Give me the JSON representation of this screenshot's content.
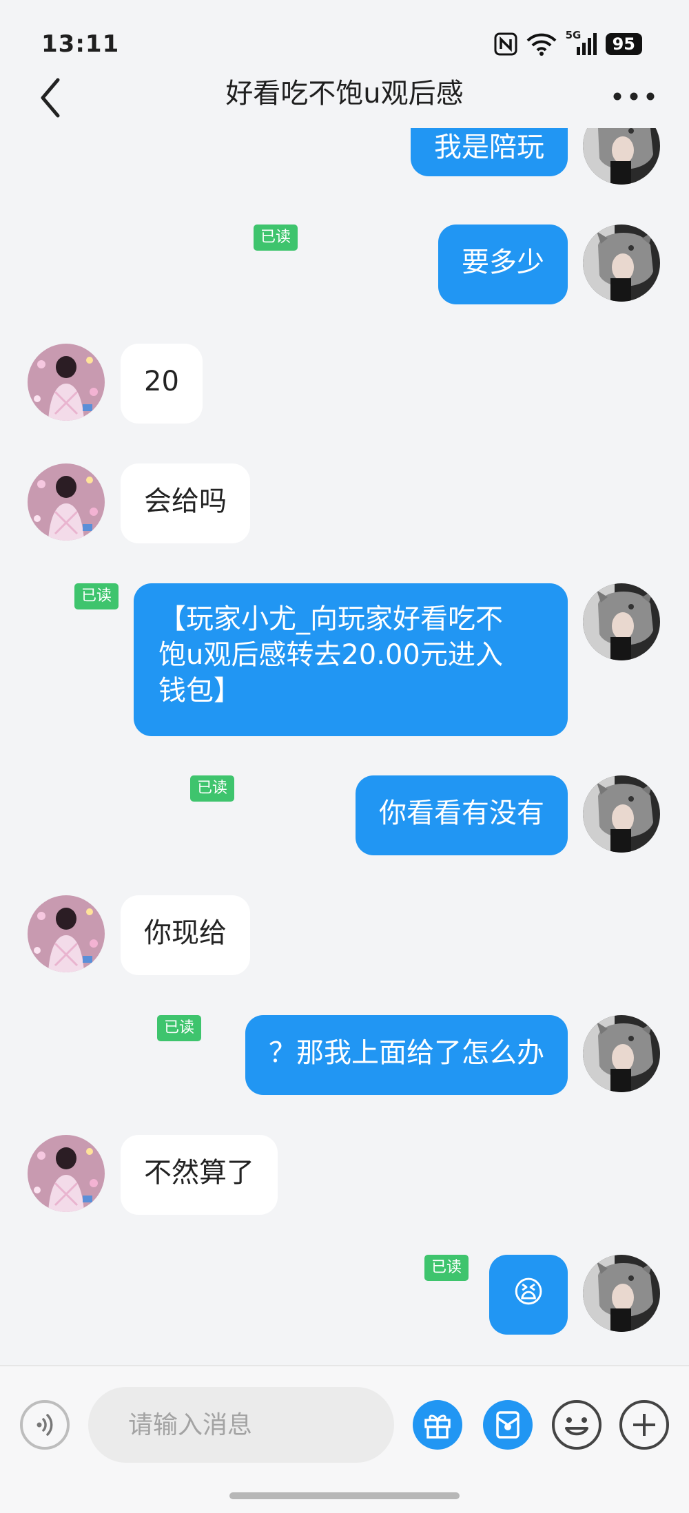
{
  "status_bar": {
    "time": "13:11",
    "network": "5G",
    "battery": "95"
  },
  "header": {
    "title": "好看吃不饱u观后感"
  },
  "messages": [
    {
      "side": "out",
      "text": "我是陪玩",
      "read": ""
    },
    {
      "side": "out",
      "text": "要多少",
      "read": "已读"
    },
    {
      "side": "in",
      "text": "20"
    },
    {
      "side": "in",
      "text": "会给吗"
    },
    {
      "side": "out",
      "text": "【玩家小尤_向玩家好看吃不饱u观后感转去20.00元进入钱包】",
      "lines": [
        "【玩家小尤_向玩家好看吃不",
        "饱u观后感转去20.00元进入",
        "钱包】"
      ],
      "read": "已读"
    },
    {
      "side": "out",
      "text": "你看看有没有",
      "read": "已读"
    },
    {
      "side": "in",
      "text": "你现给"
    },
    {
      "side": "out",
      "text": "？那我上面给了怎么办",
      "read": "已读"
    },
    {
      "side": "in",
      "text": "不然算了"
    },
    {
      "side": "out",
      "text": "😫",
      "read": "已读"
    }
  ],
  "input": {
    "placeholder": "请输入消息"
  },
  "bottom_icons": [
    "voice-icon",
    "gift-icon",
    "red-packet-icon",
    "emoji-icon",
    "plus-icon"
  ],
  "colors": {
    "accent": "#2196f3",
    "read_badge": "#3ec46d",
    "background": "#f3f4f6"
  }
}
